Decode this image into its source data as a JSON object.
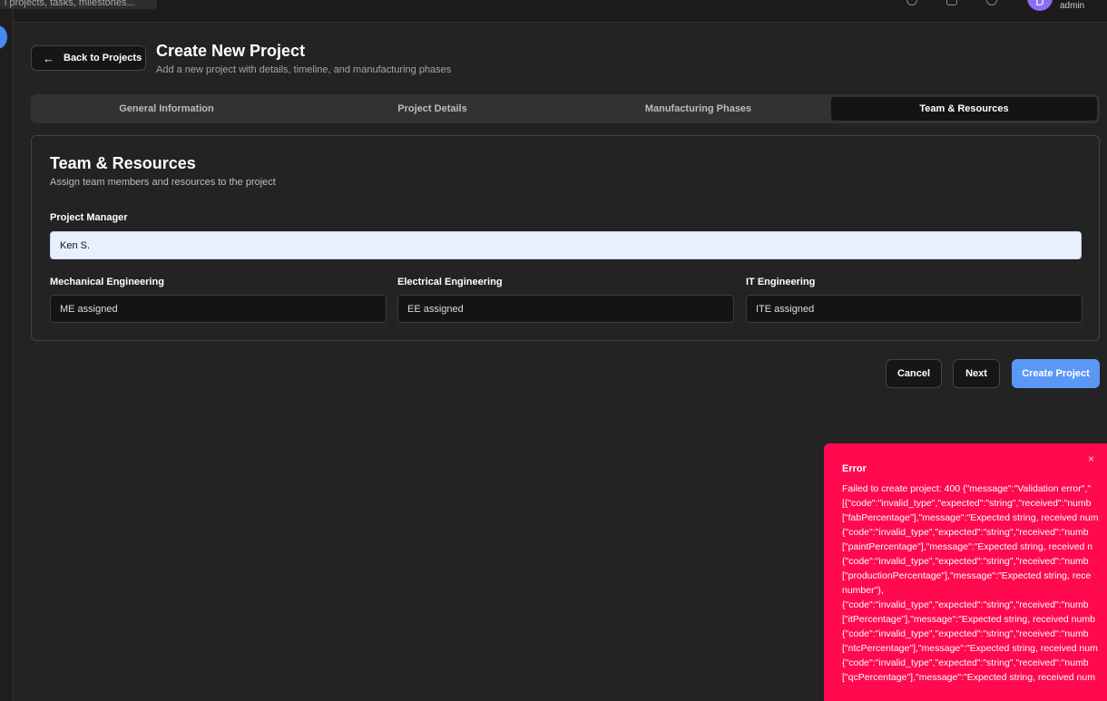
{
  "header": {
    "search_placeholder": "l projects, tasks, milestones...",
    "avatar_initial": "D",
    "user_role": "admin"
  },
  "page": {
    "back_label": "Back to Projects",
    "title": "Create New Project",
    "subtitle": "Add a new project with details, timeline, and manufacturing phases"
  },
  "tabs": [
    {
      "label": "General Information",
      "active": false
    },
    {
      "label": "Project Details",
      "active": false
    },
    {
      "label": "Manufacturing Phases",
      "active": false
    },
    {
      "label": "Team & Resources",
      "active": true
    }
  ],
  "card": {
    "title": "Team & Resources",
    "description": "Assign team members and resources to the project",
    "project_manager_label": "Project Manager",
    "project_manager_value": "Ken S.",
    "mechanical_label": "Mechanical Engineering",
    "mechanical_value": "ME assigned",
    "electrical_label": "Electrical Engineering",
    "electrical_value": "EE assigned",
    "it_label": "IT Engineering",
    "it_value": "ITE assigned"
  },
  "actions": {
    "cancel": "Cancel",
    "next": "Next",
    "create": "Create Project"
  },
  "toast": {
    "close": "×",
    "title": "Error",
    "lines": [
      "Failed to create project: 400 {\"message\":\"Validation error\",\"",
      "[{\"code\":\"invalid_type\",\"expected\":\"string\",\"received\":\"numb",
      "[\"fabPercentage\"],\"message\":\"Expected string, received num",
      "{\"code\":\"invalid_type\",\"expected\":\"string\",\"received\":\"numb",
      "[\"paintPercentage\"],\"message\":\"Expected string, received n",
      "{\"code\":\"invalid_type\",\"expected\":\"string\",\"received\":\"numb",
      "[\"productionPercentage\"],\"message\":\"Expected string, rece",
      "number\"},",
      "{\"code\":\"invalid_type\",\"expected\":\"string\",\"received\":\"numb",
      "[\"itPercentage\"],\"message\":\"Expected string, received numb",
      "{\"code\":\"invalid_type\",\"expected\":\"string\",\"received\":\"numb",
      "[\"ntcPercentage\"],\"message\":\"Expected string, received num",
      "{\"code\":\"invalid_type\",\"expected\":\"string\",\"received\":\"numb",
      "[\"qcPercentage\"],\"message\":\"Expected string, received num"
    ]
  },
  "colors": {
    "background": "#232323",
    "primary": "#5b98f5",
    "error": "#ff0a4e",
    "avatar": "#8b6cf6"
  }
}
